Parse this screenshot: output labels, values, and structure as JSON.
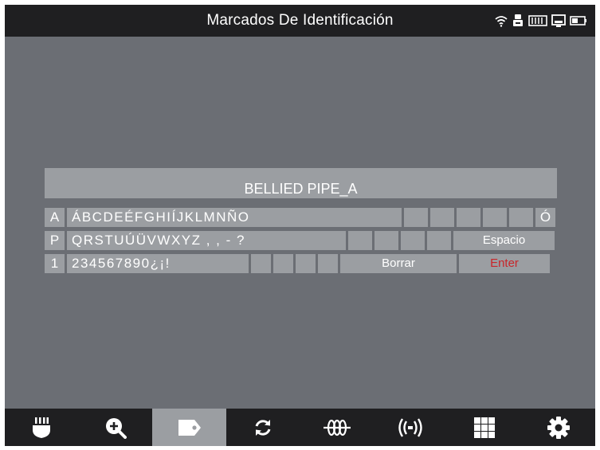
{
  "header": {
    "title": "Marcados De Identificación"
  },
  "status_icons": [
    "wifi-icon",
    "robot-icon",
    "keyboard-status-icon",
    "monitor-icon",
    "battery-icon"
  ],
  "keyboard": {
    "input_value": "BELLIED PIPE_A",
    "row1": {
      "k1": "A",
      "text": "ÁBCDEÉFGHIÍJKLMNÑO",
      "last": "Ó"
    },
    "row2": {
      "k1": "P",
      "text": "QRSTUÚÜVWXYZ , , - ?",
      "space": "Espacio"
    },
    "row3": {
      "k1": "1",
      "text": "234567890¿¡!",
      "delete": "Borrar",
      "enter": "Enter"
    }
  },
  "toolbar": {
    "active_index": 2,
    "tools": [
      "probe-icon",
      "zoom-in-icon",
      "tag-icon",
      "refresh-icon",
      "coil-icon",
      "signal-icon",
      "grid-icon",
      "gear-icon"
    ]
  },
  "colors": {
    "background": "#6b6e74",
    "bar": "#1f1f21",
    "key": "#9b9ea2",
    "enter_text": "#c8262a"
  }
}
